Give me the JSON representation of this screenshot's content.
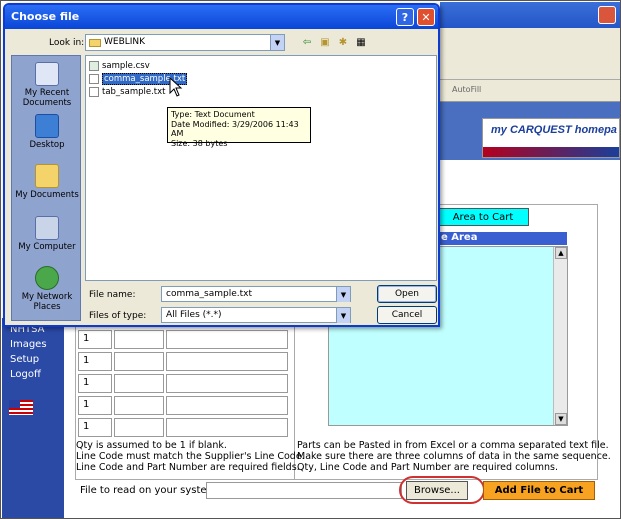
{
  "dialog": {
    "title": "Choose file",
    "help": "?",
    "close": "✕",
    "look_in_label": "Look in:",
    "look_in_value": "WEBLINK",
    "places": [
      {
        "label": "My Recent Documents"
      },
      {
        "label": "Desktop"
      },
      {
        "label": "My Documents"
      },
      {
        "label": "My Computer"
      },
      {
        "label": "My Network Places"
      }
    ],
    "files": [
      {
        "name": "sample.csv",
        "selected": false
      },
      {
        "name": "comma_sample.txt",
        "selected": true
      },
      {
        "name": "tab_sample.txt",
        "selected": false
      }
    ],
    "tooltip": {
      "type": "Type: Text Document",
      "modified": "Date Modified: 3/29/2006 11:43 AM",
      "size": "Size: 38 bytes"
    },
    "file_name_label": "File name:",
    "file_name_value": "comma_sample.txt",
    "files_of_type_label": "Files of type:",
    "files_of_type_value": "All Files (*.*)",
    "open_label": "Open",
    "cancel_label": "Cancel"
  },
  "browser": {
    "autofill": "AutoFill",
    "logo_text": "my CARQUEST homepa"
  },
  "nav": {
    "items": [
      "NHTSA",
      "Images",
      "Setup",
      "Logoff"
    ]
  },
  "main": {
    "area_to_cart": "Area to Cart",
    "paste_header": "e Area",
    "qty_values": [
      "1",
      "1",
      "1",
      "1",
      "1"
    ],
    "left_notes": [
      "Qty is assumed to be 1 if blank.",
      "Line Code must match the Supplier's Line Code.",
      "Line Code and Part Number are required fields."
    ],
    "right_notes": [
      "Parts can be Pasted in from Excel or a comma separated text file.",
      "Make sure there are three columns of data in the same sequence.",
      "Qty, Line Code and Part Number are required columns."
    ],
    "file_label": "File to read on your system :",
    "browse_label": "Browse...",
    "add_file_label": "Add File to Cart"
  }
}
